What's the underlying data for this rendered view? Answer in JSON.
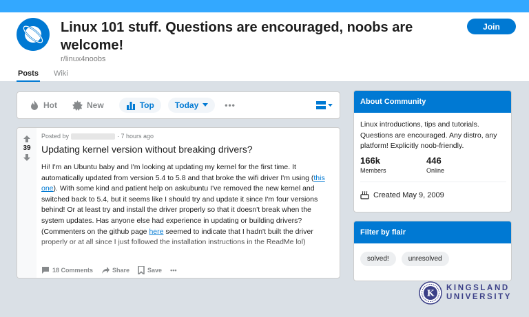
{
  "subreddit": {
    "title": "Linux 101 stuff. Questions are encouraged, noobs are welcome!",
    "name": "r/linux4noobs",
    "join_label": "Join",
    "tabs": [
      {
        "label": "Posts"
      },
      {
        "label": "Wiki"
      }
    ],
    "active_tab": "Posts"
  },
  "sortbar": {
    "hot": "Hot",
    "new": "New",
    "top": "Top",
    "period": "Today",
    "more": "•••"
  },
  "post": {
    "posted_by_label": "Posted by",
    "time": "· 7 hours ago",
    "votes": "39",
    "title": "Updating kernel version without breaking drivers?",
    "body_1": "Hi! I'm an Ubuntu baby and I'm looking at updating my kernel for the first time. It automatically updated from version 5.4 to 5.8 and that broke the wifi driver I'm using (",
    "link_1": "this one",
    "body_2": "). With some kind and patient help on askubuntu I've removed the new kernel and switched back to 5.4, but it seems like I should try and update it since I'm four versions behind! Or at least try and install the driver properly so that it doesn't break when the system updates. Has anyone else had experience in updating or building drivers? (Commenters on the github page ",
    "link_2": "here",
    "body_3": " seemed to indicate that I hadn't built the driver properly or at all since I just followed the installation instructions in the ReadMe lol)",
    "comments": "18 Comments",
    "share": "Share",
    "save": "Save",
    "more": "•••"
  },
  "about": {
    "header": "About Community",
    "description": "Linux introductions, tips and tutorials. Questions are encouraged. Any distro, any platform! Explicitly noob-friendly.",
    "members_count": "166k",
    "members_label": "Members",
    "online_count": "446",
    "online_label": "Online",
    "created": "Created May 9, 2009"
  },
  "flair": {
    "header": "Filter by flair",
    "chips": [
      {
        "label": "solved!"
      },
      {
        "label": "unresolved"
      }
    ]
  },
  "watermark": {
    "line1": "KINGSLAND",
    "line2": "UNIVERSITY",
    "seal_letter": "K"
  },
  "colors": {
    "accent": "#0079d3",
    "banner": "#33a8ff",
    "background": "#dae0e6"
  }
}
